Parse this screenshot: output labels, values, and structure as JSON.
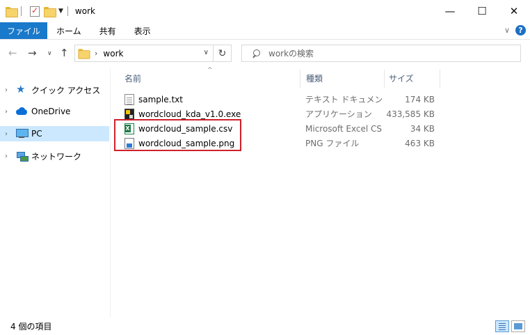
{
  "window": {
    "title": "work",
    "minimize": "—",
    "maximize": "☐",
    "close": "✕"
  },
  "ribbon": {
    "tabs": [
      "ファイル",
      "ホーム",
      "共有",
      "表示"
    ],
    "expand_icon": "chevron-down-icon",
    "help": "?"
  },
  "nav": {
    "back": "←",
    "forward": "→",
    "recent": "∨",
    "up": "↑",
    "address": {
      "separator": "›",
      "crumb": "work",
      "dropdown": "∨"
    },
    "refresh": "↻",
    "search_placeholder": "workの検索"
  },
  "sidebar": {
    "items": [
      {
        "label": "クイック アクセス",
        "icon": "quick-access-icon",
        "selected": false
      },
      {
        "label": "OneDrive",
        "icon": "onedrive-icon",
        "selected": false
      },
      {
        "label": "PC",
        "icon": "pc-icon",
        "selected": true
      },
      {
        "label": "ネットワーク",
        "icon": "network-icon",
        "selected": false
      }
    ],
    "expand": "›"
  },
  "columns": {
    "name": "名前",
    "type": "種類",
    "size": "サイズ",
    "sort_arrow": "^"
  },
  "files": [
    {
      "name": "sample.txt",
      "type": "テキスト ドキュメント",
      "size": "174 KB",
      "icon": "text-file-icon"
    },
    {
      "name": "wordcloud_kda_v1.0.exe",
      "type": "アプリケーション",
      "size": "433,585 KB",
      "icon": "exe-file-icon"
    },
    {
      "name": "wordcloud_sample.csv",
      "type": "Microsoft Excel CS...",
      "size": "34 KB",
      "icon": "excel-csv-icon"
    },
    {
      "name": "wordcloud_sample.png",
      "type": "PNG ファイル",
      "size": "463 KB",
      "icon": "png-file-icon"
    }
  ],
  "highlight_color": "#d0202a",
  "status": {
    "item_count": "4 個の項目"
  }
}
